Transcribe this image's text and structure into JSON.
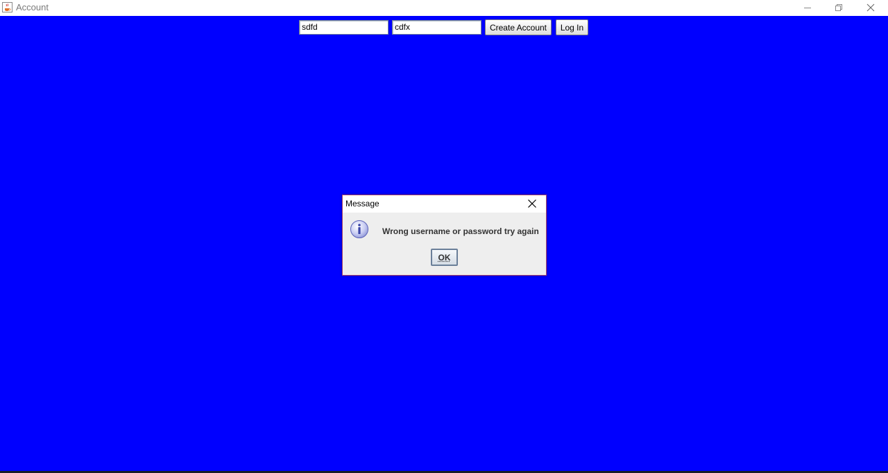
{
  "window": {
    "title": "Account",
    "app_icon": "java-cup-icon"
  },
  "toolbar": {
    "username_value": "sdfd",
    "password_value": "cdfx",
    "create_account_label": "Create Account",
    "login_label": "Log In"
  },
  "dialog": {
    "title": "Message",
    "icon": "info-icon",
    "message": "Wrong username or password try again",
    "ok_label": "OK"
  },
  "colors": {
    "background": "#0000ff",
    "dialog_border": "#b04a6a"
  }
}
